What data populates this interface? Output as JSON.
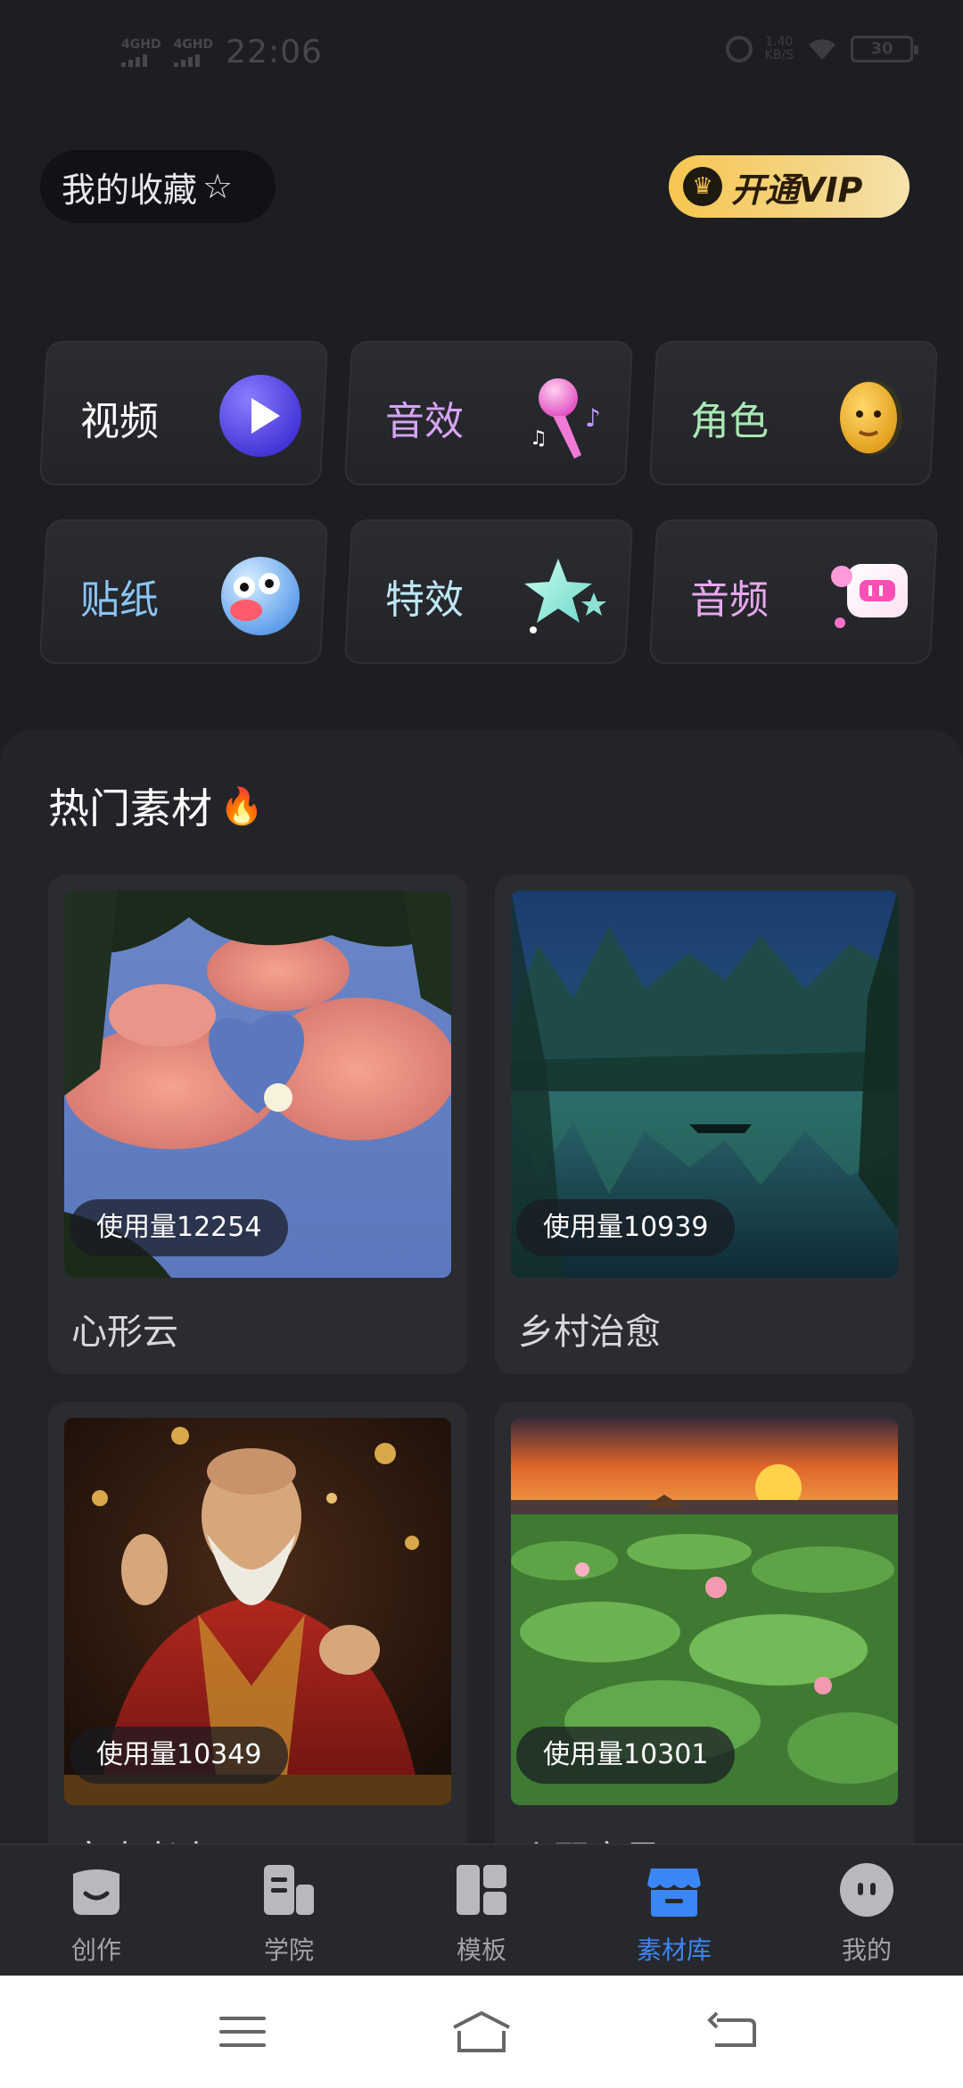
{
  "status_bar": {
    "sim1": "4GHD",
    "sim2": "4GHD",
    "time": "22:06",
    "net_speed_value": "1.40",
    "net_speed_unit": "KB/S",
    "battery": "30"
  },
  "header": {
    "favorites_label": "我的收藏",
    "vip_label": "开通VIP"
  },
  "categories": [
    {
      "label": "视频",
      "color": "#ffffff",
      "icon": "play-icon"
    },
    {
      "label": "音效",
      "color": "#d6a4f5",
      "icon": "microphone-icon"
    },
    {
      "label": "角色",
      "color": "#a8e8b3",
      "icon": "face-icon"
    },
    {
      "label": "贴纸",
      "color": "#8cc6f7",
      "icon": "sticker-face-icon"
    },
    {
      "label": "特效",
      "color": "#bfe6f5",
      "icon": "star-icon"
    },
    {
      "label": "音频",
      "color": "#e8a7ee",
      "icon": "audio-chat-icon"
    }
  ],
  "hot": {
    "title": "热门素材",
    "items": [
      {
        "usage": "使用量12254",
        "title": "心形云"
      },
      {
        "usage": "使用量10939",
        "title": "乡村治愈"
      },
      {
        "usage": "使用量10349",
        "title": "富贵老人"
      },
      {
        "usage": "使用量10301",
        "title": "乡野宁景"
      }
    ]
  },
  "bottom_nav": [
    {
      "label": "创作",
      "icon": "create-icon",
      "active": false
    },
    {
      "label": "学院",
      "icon": "academy-icon",
      "active": false
    },
    {
      "label": "模板",
      "icon": "template-icon",
      "active": false
    },
    {
      "label": "素材库",
      "icon": "store-icon",
      "active": true
    },
    {
      "label": "我的",
      "icon": "profile-icon",
      "active": false
    }
  ],
  "colors": {
    "background": "#1d1e22",
    "active_tab": "#3b86f7",
    "vip_gold": "#f6c64f"
  }
}
